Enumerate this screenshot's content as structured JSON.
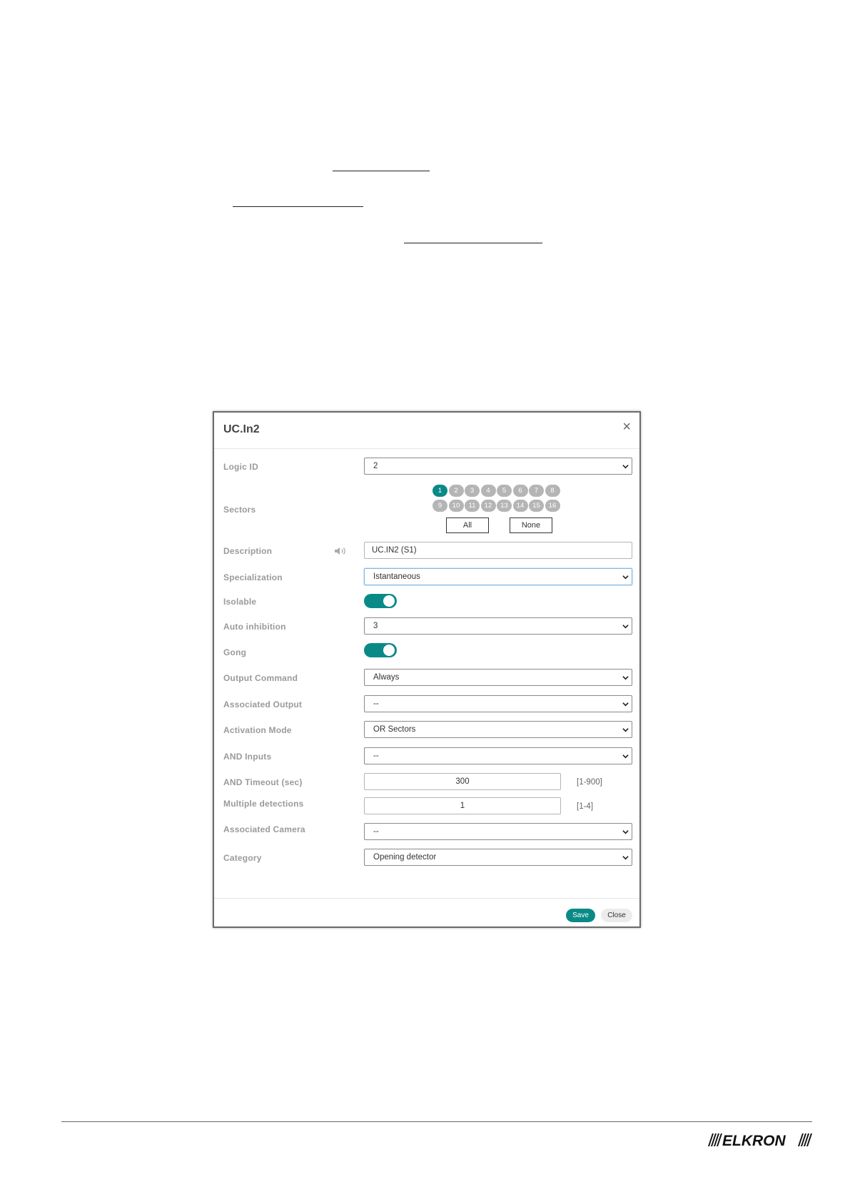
{
  "dialog": {
    "title": "UC.In2",
    "close_glyph": "×",
    "fields": {
      "logic_id": {
        "label": "Logic ID",
        "value": "2"
      },
      "sectors": {
        "label": "Sectors",
        "items": [
          "1",
          "2",
          "3",
          "4",
          "5",
          "6",
          "7",
          "8",
          "9",
          "10",
          "11",
          "12",
          "13",
          "14",
          "15",
          "16"
        ],
        "active": [
          "1"
        ],
        "all_label": "All",
        "none_label": "None"
      },
      "description": {
        "label": "Description",
        "value": "UC.IN2 (S1)",
        "icon": "speaker-icon"
      },
      "specialization": {
        "label": "Specialization",
        "value": "Istantaneous"
      },
      "isolable": {
        "label": "Isolable",
        "on": true
      },
      "auto_inhibition": {
        "label": "Auto inhibition",
        "value": "3"
      },
      "gong": {
        "label": "Gong",
        "on": true
      },
      "output_command": {
        "label": "Output Command",
        "value": "Always"
      },
      "associated_output": {
        "label": "Associated Output",
        "value": "--"
      },
      "activation_mode": {
        "label": "Activation Mode",
        "value": "OR Sectors"
      },
      "and_inputs": {
        "label": "AND Inputs",
        "value": "--"
      },
      "and_timeout": {
        "label": "AND Timeout (sec)",
        "value": "300",
        "range": "[1-900]"
      },
      "multiple_detections": {
        "label": "Multiple detections",
        "value": "1",
        "range": "[1-4]"
      },
      "associated_camera": {
        "label": "Associated Camera",
        "value": "--"
      },
      "category": {
        "label": "Category",
        "value": "Opening detector"
      }
    },
    "footer": {
      "save_label": "Save",
      "close_label": "Close"
    }
  },
  "brand": {
    "accent": "#0a8a87",
    "logo_text": "ELKRON"
  }
}
